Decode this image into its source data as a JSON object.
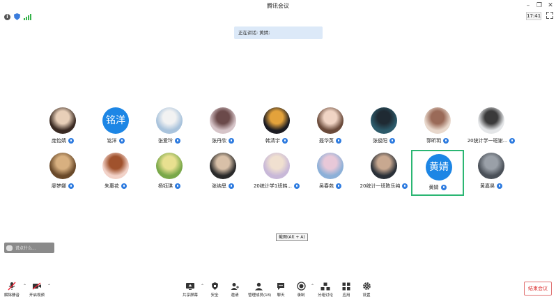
{
  "window": {
    "title": "腾讯会议",
    "controls": [
      "minimize",
      "restore",
      "close"
    ]
  },
  "infobar": {
    "icons": [
      "info-icon",
      "shield-icon",
      "signal-icon"
    ]
  },
  "clock": "17:41",
  "speaking": "正在讲话: 黄婧;",
  "participants": [
    {
      "name": "庞怡婧",
      "avatar": "photo"
    },
    {
      "name": "铭洋",
      "avatar": "text",
      "avatar_text": "铭洋"
    },
    {
      "name": "张爱玲",
      "avatar": "photo"
    },
    {
      "name": "张丹欣",
      "avatar": "photo"
    },
    {
      "name": "韩清宇",
      "avatar": "photo"
    },
    {
      "name": "聂华英",
      "avatar": "photo"
    },
    {
      "name": "张俊阳",
      "avatar": "photo"
    },
    {
      "name": "郭昕玥",
      "avatar": "photo"
    },
    {
      "name": "20统计学一班谢...",
      "avatar": "photo"
    },
    {
      "name": "廖梦娜",
      "avatar": "photo"
    },
    {
      "name": "朱惠花",
      "avatar": "photo"
    },
    {
      "name": "杨钰琪",
      "avatar": "photo"
    },
    {
      "name": "张纳思",
      "avatar": "photo"
    },
    {
      "name": "20统计学1班韩...",
      "avatar": "photo"
    },
    {
      "name": "吴春苑",
      "avatar": "photo"
    },
    {
      "name": "20统计一班陈乐纯",
      "avatar": "photo"
    },
    {
      "name": "黄婧",
      "avatar": "text",
      "avatar_text": "黄婧",
      "active": true
    },
    {
      "name": "黄嘉昊",
      "avatar": "photo"
    }
  ],
  "chat": {
    "placeholder": "说点什么..."
  },
  "tooltip": "截图(Alt + A)",
  "toolbar": {
    "unmute": "解除静音",
    "video": "开启视频",
    "share": "共享屏幕",
    "security": "安全",
    "invite": "邀请",
    "members": "管理成员(18)",
    "chat": "聊天",
    "record": "录制",
    "breakout": "分组讨论",
    "apps": "应用",
    "settings": "设置",
    "end": "结束会议"
  },
  "colors": {
    "accent": "#1d86e5",
    "active_border": "#2bb673",
    "end": "#dd3333"
  }
}
